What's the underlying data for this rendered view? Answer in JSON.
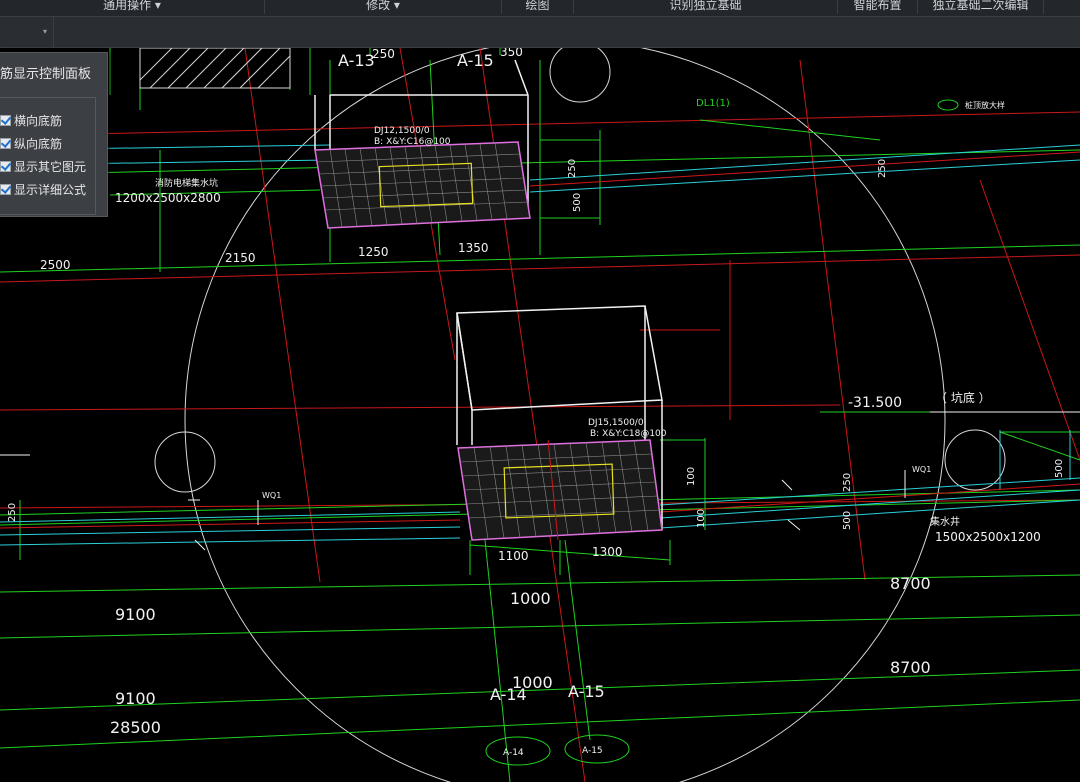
{
  "menu": {
    "items": [
      {
        "label": "通用操作 ▾"
      },
      {
        "label": "修改 ▾"
      },
      {
        "label": "绘图"
      },
      {
        "label": "识别独立基础"
      },
      {
        "label": "智能布置"
      },
      {
        "label": "独立基础二次编辑"
      }
    ]
  },
  "toolbar": {
    "dropdown_arrow": "▾"
  },
  "panel": {
    "title": "筋显示控制面板",
    "options": [
      {
        "label": "横向底筋",
        "checked": true
      },
      {
        "label": "纵向底筋",
        "checked": true
      },
      {
        "label": "显示其它图元",
        "checked": true
      },
      {
        "label": "显示详细公式",
        "checked": true
      }
    ]
  },
  "drawing": {
    "axis_labels": [
      "A-13",
      "A-15",
      "A-14",
      "A-15"
    ],
    "axis_bubbles": [
      "A-14",
      "A-15"
    ],
    "upper_foundation": {
      "label1": "DJ12,1500/0",
      "label2": "B: X&Y:C16@100"
    },
    "lower_foundation": {
      "label1": "DJ15,1500/0",
      "label2": "B: X&Y:C18@100"
    },
    "pit_note_left": "消防电梯集水坑",
    "pit_size_left": "1200x2500x2800",
    "pit_note_right": "集水井",
    "pit_size_right": "1500x2500x1200",
    "elevation": "-31.500",
    "pit_bottom": "（ 坑底 ）",
    "beam_label": "DL1(1)",
    "detail_note": "桩顶放大样",
    "wall_label": "WQ1",
    "dims_top": [
      "2500",
      "2150",
      "1250",
      "1350",
      "250",
      "350"
    ],
    "dims_mid": [
      "1100",
      "1300"
    ],
    "dims_big": [
      "1000",
      "9100",
      "8700",
      "1000",
      "9100",
      "8700",
      "28500"
    ],
    "vertical_dims": [
      "250",
      "500",
      "100",
      "100",
      "250",
      "500",
      "250",
      "500",
      "250"
    ]
  },
  "colors": {
    "green": "#1fd21f",
    "cyan": "#2ad0d8",
    "red": "#d01818",
    "white": "#f2f2f2",
    "magenta": "#e070e0",
    "yellow": "#e8e020",
    "background": "#000000",
    "panel_bg": "#3c3f44"
  }
}
